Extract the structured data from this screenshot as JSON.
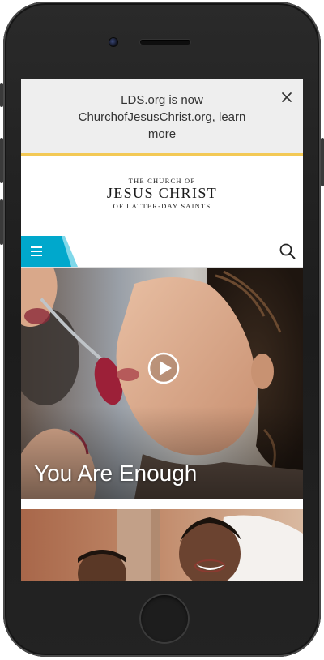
{
  "banner": {
    "message": "LDS.org is now ChurchofJesusChrist.org, learn more",
    "close_icon": "close-icon"
  },
  "logo": {
    "line1": "THE CHURCH OF",
    "line2": "JESUS CHRIST",
    "line3": "OF LATTER-DAY SAINTS"
  },
  "nav": {
    "menu_icon": "hamburger-menu-icon",
    "search_icon": "search-icon",
    "accent_color": "#00a8cc"
  },
  "hero": {
    "title": "You Are Enough",
    "play_icon": "play-icon"
  },
  "colors": {
    "banner_background": "#eeeeee",
    "banner_border": "#f3c955",
    "accent": "#00a8cc"
  }
}
